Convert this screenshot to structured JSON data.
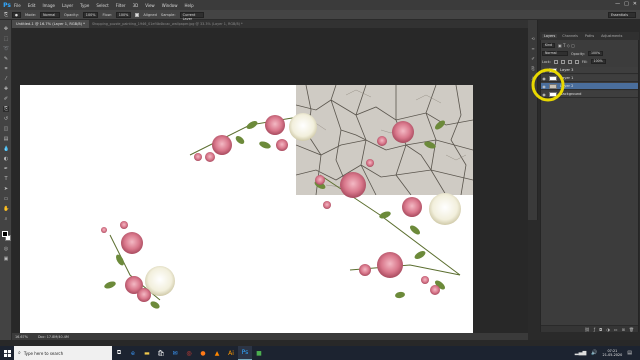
{
  "app": {
    "logo": "Ps"
  },
  "menu": [
    "File",
    "Edit",
    "Image",
    "Layer",
    "Type",
    "Select",
    "Filter",
    "3D",
    "View",
    "Window",
    "Help"
  ],
  "window_controls": {
    "minimize": "—",
    "maximize": "□",
    "close": "✕"
  },
  "options_bar": {
    "mode_label": "Mode:",
    "mode_value": "Normal",
    "opacity_label": "Opacity:",
    "opacity_value": "100%",
    "flow_label": "Flow:",
    "flow_value": "100%",
    "aligned_label": "Aligned",
    "sample_label": "Sample:",
    "sample_value": "Current Layer",
    "workspace": "Essentials"
  },
  "document": {
    "tab_title": "Untitled-1 @ 16.7% (Layer 1, RGB/8) *",
    "tab_other": "Shopping_puzzle_painting_1946_01ef4b4bcac_wallpaper.jpg @ 33.3% (Layer 1, RGB/8) *"
  },
  "status_bar": {
    "zoom": "16.67%",
    "doc": "Doc: 17.8M/40.4M"
  },
  "panels": {
    "tabs": [
      "Layers",
      "Channels",
      "Paths",
      "Adjustments"
    ],
    "kind_label": "Kind",
    "blend_mode": "Normal",
    "opacity_label": "Opacity:",
    "opacity_value": "100%",
    "lock_label": "Lock:",
    "fill_label": "Fill:",
    "fill_value": "100%",
    "layers": [
      {
        "name": "Layer 3",
        "selected": false
      },
      {
        "name": "Layer 1",
        "selected": false
      },
      {
        "name": "Layer 2",
        "selected": true
      },
      {
        "name": "Background",
        "selected": false
      }
    ],
    "bottom_icons": [
      "link-icon",
      "fx-icon",
      "mask-icon",
      "adjustment-icon",
      "folder-icon",
      "new-layer-icon",
      "trash-icon"
    ]
  },
  "taskbar": {
    "search_placeholder": "Type here to search",
    "time": "07:21",
    "date": "21-05-2020"
  },
  "colors": {
    "accent_ps": "#31a8ff",
    "selected_layer": "#4a6e9c",
    "highlight_circle": "#e8d800",
    "canvas": "#ffffff"
  }
}
